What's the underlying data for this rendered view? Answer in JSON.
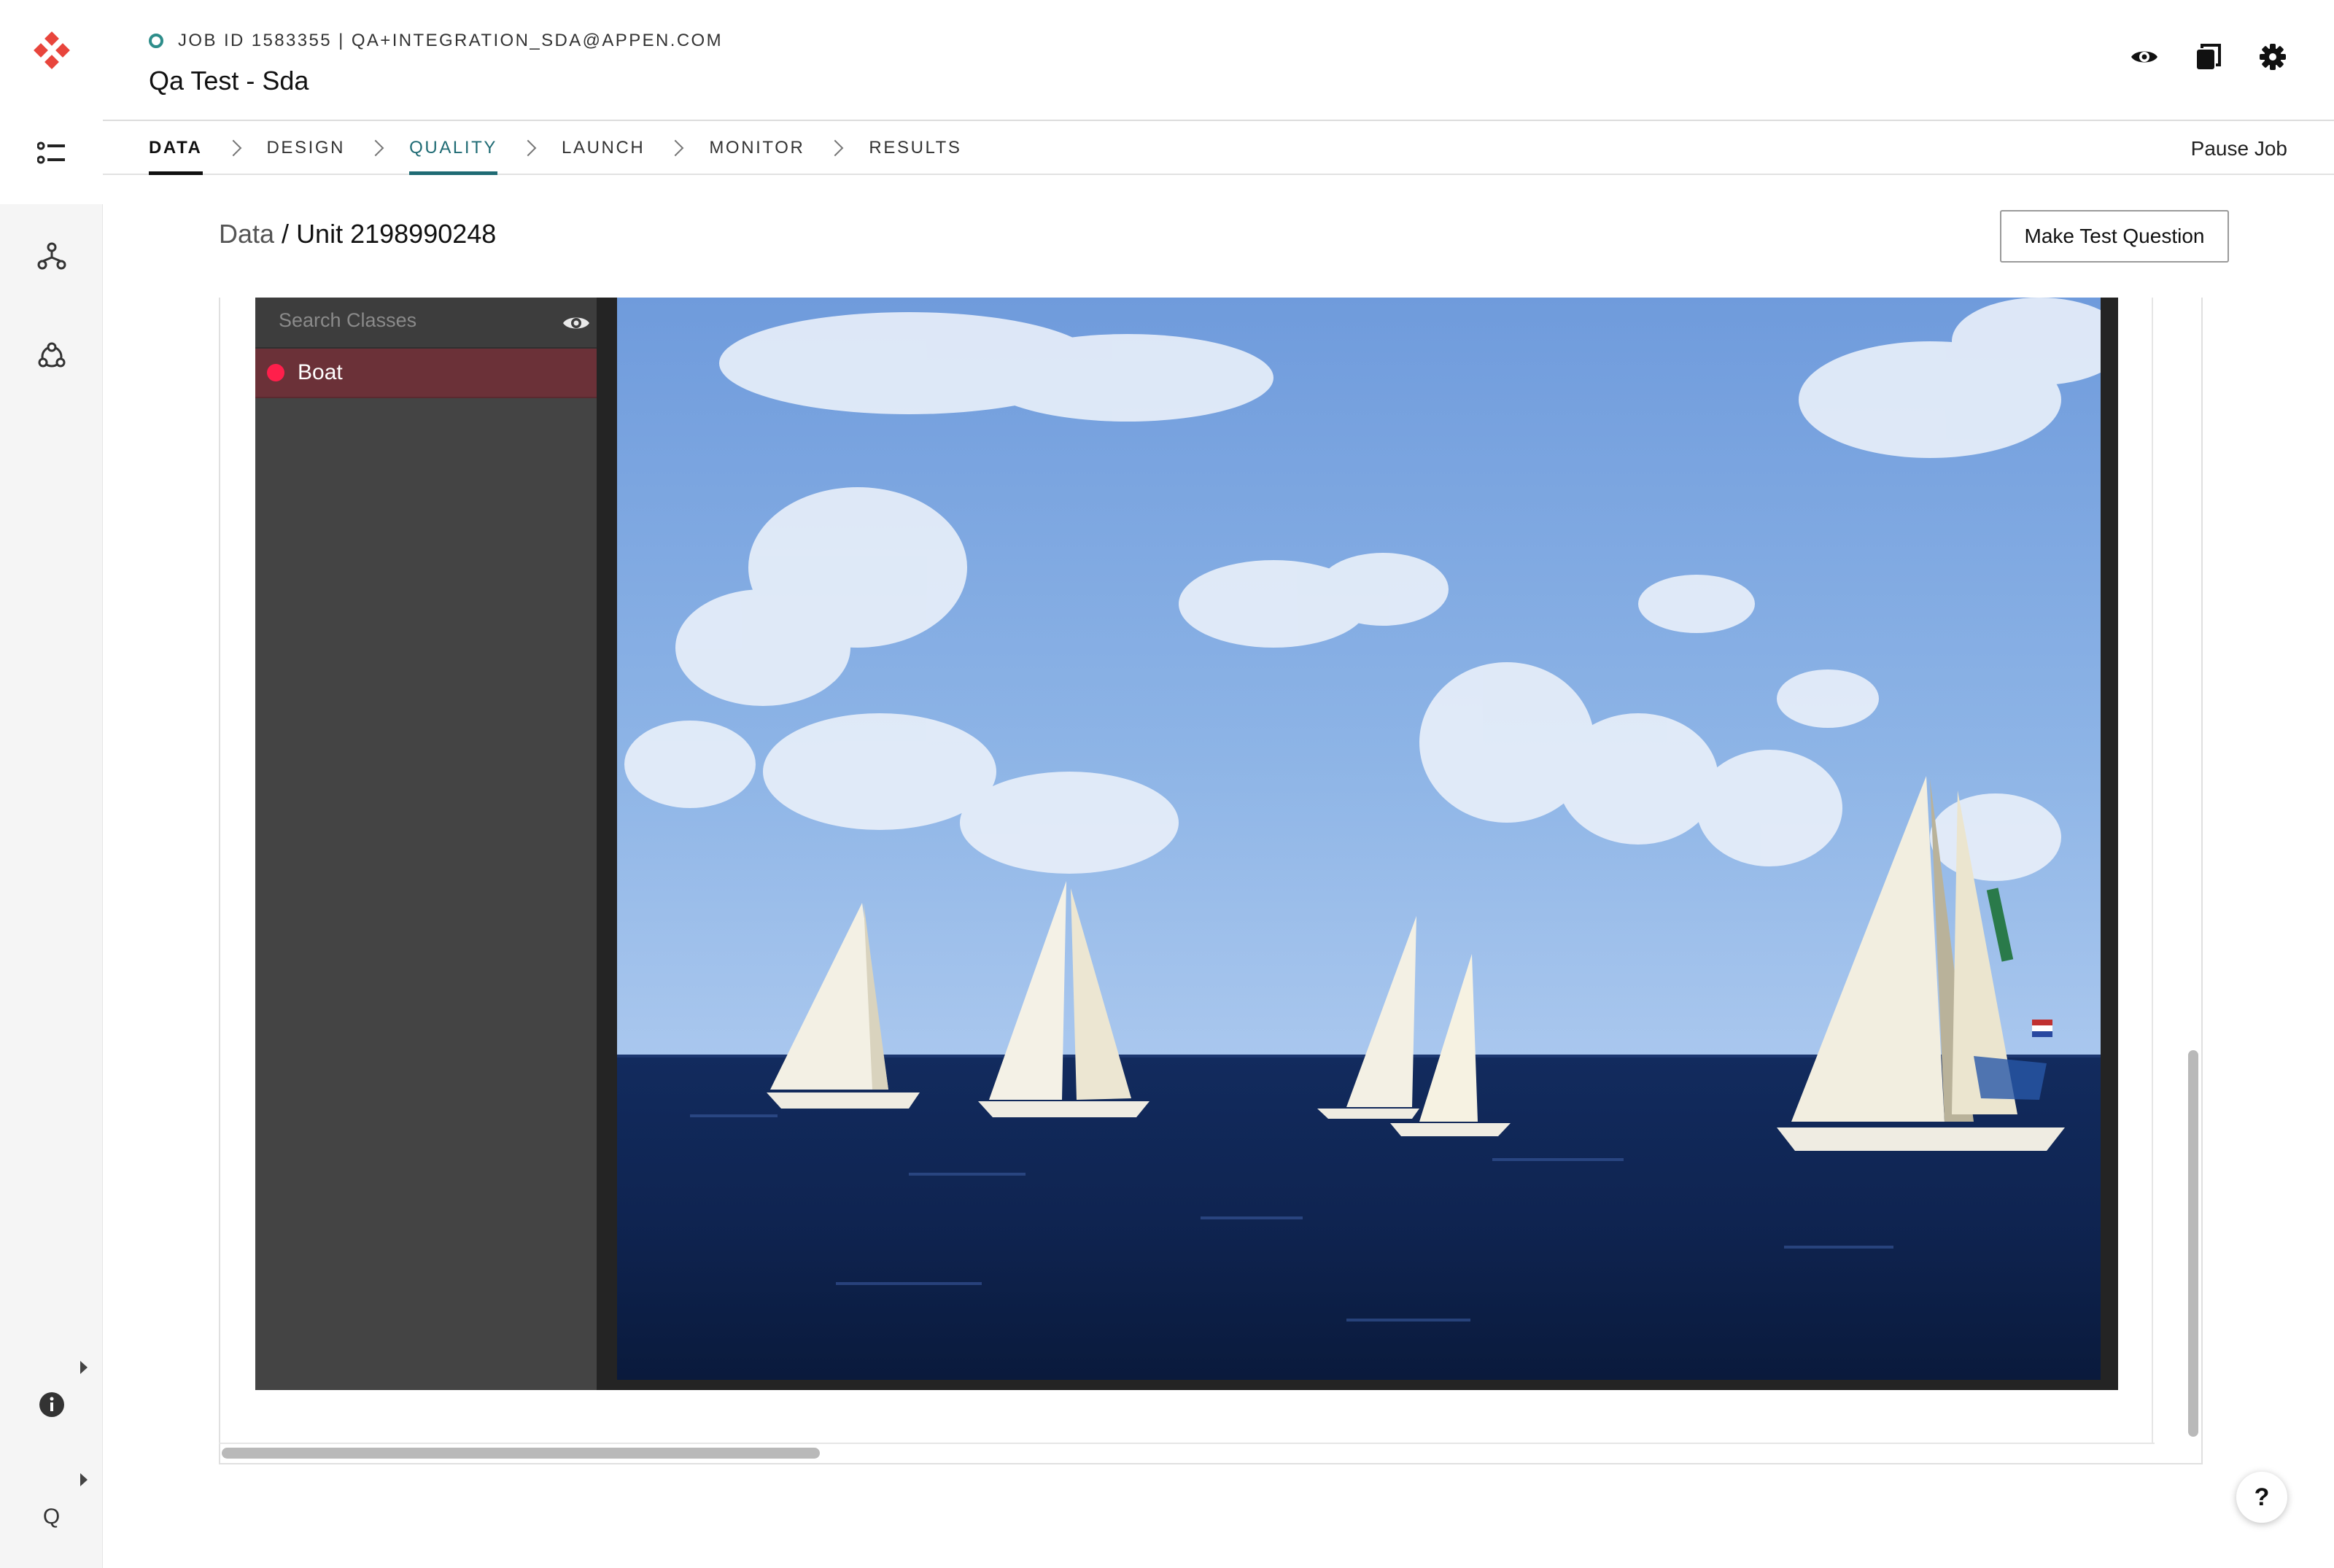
{
  "header": {
    "job_line": "JOB ID 1583355 | QA+INTEGRATION_SDA@APPEN.COM",
    "title": "Qa Test - Sda"
  },
  "tabs": [
    {
      "label": "DATA",
      "state": "active"
    },
    {
      "label": "DESIGN",
      "state": "default"
    },
    {
      "label": "QUALITY",
      "state": "highlighted"
    },
    {
      "label": "LAUNCH",
      "state": "default"
    },
    {
      "label": "MONITOR",
      "state": "default"
    },
    {
      "label": "RESULTS",
      "state": "default"
    }
  ],
  "pause_label": "Pause Job",
  "breadcrumb": {
    "root": "Data",
    "separator": " / ",
    "current": "Unit 2198990248"
  },
  "make_test_question_label": "Make Test Question",
  "annotation": {
    "search_placeholder": "Search Classes",
    "classes": [
      {
        "label": "Boat",
        "color": "#ff1f4b"
      }
    ]
  },
  "rail": {
    "bottom_label": "Q"
  },
  "help_label": "?",
  "colors": {
    "brand": "#e8453c",
    "accent_teal": "#1f6b74",
    "status_ring": "#2d8d8a"
  },
  "icons": [
    "appen-logo-icon",
    "tasks-list-icon",
    "workflow-icon",
    "hub-icon",
    "info-icon",
    "eye-icon",
    "copy-icon",
    "gear-icon"
  ]
}
